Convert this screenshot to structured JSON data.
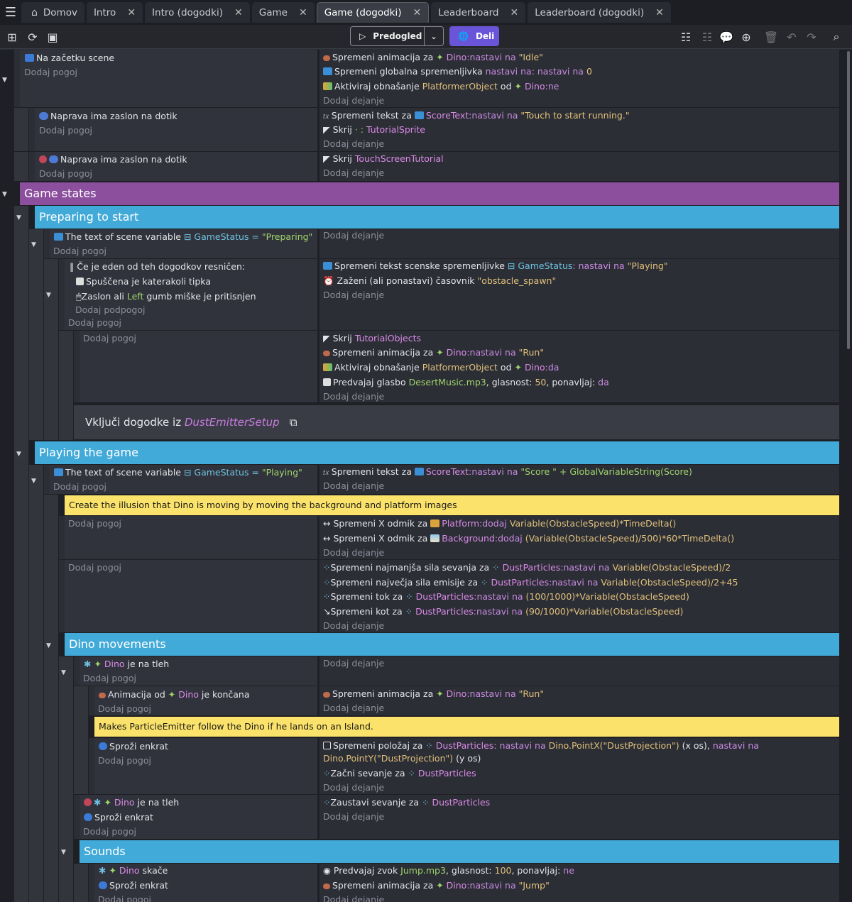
{
  "tabs": [
    {
      "label": "Domov",
      "closable": false
    },
    {
      "label": "Intro",
      "closable": true
    },
    {
      "label": "Intro (dogodki)",
      "closable": true
    },
    {
      "label": "Game",
      "closable": true
    },
    {
      "label": "Game (dogodki)",
      "closable": true,
      "active": true
    },
    {
      "label": "Leaderboard",
      "closable": true
    },
    {
      "label": "Leaderboard (dogodki)",
      "closable": true
    }
  ],
  "toolbar": {
    "preview_label": "Predogled",
    "share_label": "Deli"
  },
  "common": {
    "add_condition": "Dodaj pogoj",
    "add_action": "Dodaj dejanje",
    "add_subcondition": "Dodaj podpogoj"
  },
  "e1": {
    "cond": "Na začetku scene",
    "a1_pre": "Spremeni animacija za ",
    "a1_obj": "Dino",
    "a1_post": ":nastavi na ",
    "a1_val": "\"Idle\"",
    "a2_pre": "Spremeni globalna spremenljivka ",
    "a2_mid": "nastavi na: nastavi na ",
    "a2_val": "0",
    "a3_pre": "Aktiviraj obnašanje ",
    "a3_beh": "PlatformerObject",
    "a3_mid": " od ",
    "a3_obj": "Dino",
    "a3_post": ":ne"
  },
  "e2": {
    "cond": "Naprava ima zaslon na dotik",
    "a1_pre": "Spremeni tekst za ",
    "a1_obj": "ScoreText",
    "a1_post": ":nastavi na ",
    "a1_val": "\"Touch to start running.\"",
    "a2_pre": "Skrij ",
    "a2_obj": "TutorialSprite"
  },
  "e3": {
    "cond": "Naprava ima zaslon na dotik",
    "a1_pre": "Skrij ",
    "a1_obj": "TouchScreenTutorial"
  },
  "g_states": "Game states",
  "g_preparing": "Preparing to start",
  "e4": {
    "c_pre": "The text of scene variable ",
    "c_var": "GameStatus",
    "c_eq": " = ",
    "c_val": "\"Preparing\""
  },
  "e5": {
    "or": "Če je eden od teh dogodkov resničen:",
    "sub1": "Spuščena je katerakoli tipka",
    "sub2_pre": "Zaslon ali ",
    "sub2_kw": "Left",
    "sub2_post": " gumb miške je pritisnjen",
    "a1_pre": "Spremeni tekst scenske spremenljivke ",
    "a1_var": "GameStatus",
    "a1_mid": ": nastavi na ",
    "a1_val": "\"Playing\"",
    "a2_pre": "Zaženi (ali ponastavi) časovnik ",
    "a2_val": "\"obstacle_spawn\""
  },
  "e6": {
    "a1_pre": "Skrij ",
    "a1_obj": "TutorialObjects",
    "a2_pre": "Spremeni animacija za ",
    "a2_obj": "Dino",
    "a2_post": ":nastavi na ",
    "a2_val": "\"Run\"",
    "a3_pre": "Aktiviraj obnašanje ",
    "a3_beh": "PlatformerObject",
    "a3_mid": " od ",
    "a3_obj": "Dino",
    "a3_post": ":da",
    "a4_pre": "Predvajaj glasbo ",
    "a4_file": "DesertMusic.mp3",
    "a4_mid": ", glasnost: ",
    "a4_vol": "50",
    "a4_mid2": ", ponavljaj: ",
    "a4_loop": "da"
  },
  "link": {
    "pre": "Vključi dogodke iz ",
    "target": "DustEmitterSetup"
  },
  "g_playing": "Playing the game",
  "e7": {
    "c_pre": "The text of scene variable ",
    "c_var": "GameStatus",
    "c_eq": " = ",
    "c_val": "\"Playing\"",
    "a1_pre": "Spremeni tekst za ",
    "a1_obj": "ScoreText",
    "a1_post": ":nastavi na ",
    "a1_val": "\"Score \" + GlobalVariableString(Score)"
  },
  "comment1": "Create the illusion that Dino is moving by moving the background and platform images",
  "e8": {
    "a1_pre": "Spremeni X odmik za ",
    "a1_obj": "Platform",
    "a1_post": ":dodaj ",
    "a1_expr": "Variable(ObstacleSpeed)*TimeDelta()",
    "a2_pre": "Spremeni X odmik za ",
    "a2_obj": "Background",
    "a2_post": ":dodaj ",
    "a2_expr": "(Variable(ObstacleSpeed)/500)*60*TimeDelta()"
  },
  "e9": {
    "a1_pre": "Spremeni najmanjša sila sevanja za ",
    "a1_obj": "DustParticles",
    "a1_post": ":nastavi na ",
    "a1_expr": "Variable(ObstacleSpeed)/2",
    "a2_pre": "Spremeni največja sila emisije za ",
    "a2_obj": "DustParticles",
    "a2_post": ":nastavi na ",
    "a2_expr": "Variable(ObstacleSpeed)/2+45",
    "a3_pre": "Spremeni tok za ",
    "a3_obj": "DustParticles",
    "a3_post": ":nastavi na ",
    "a3_expr": "(100/1000)*Variable(ObstacleSpeed)",
    "a4_pre": "Spremeni kot za ",
    "a4_obj": "DustParticles",
    "a4_post": ":nastavi na ",
    "a4_expr": "(90/1000)*Variable(ObstacleSpeed)"
  },
  "g_dino": "Dino movements",
  "e10": {
    "c_obj": "Dino",
    "c_post": " je na tleh"
  },
  "e11": {
    "c_pre": "Animacija od ",
    "c_obj": "Dino",
    "c_post": " je končana",
    "a1_pre": "Spremeni animacija za ",
    "a1_obj": "Dino",
    "a1_post": ":nastavi na ",
    "a1_val": "\"Run\""
  },
  "comment2": "Makes ParticleEmitter follow the Dino if he lands on an Island.",
  "e12": {
    "cond": "Sproži enkrat",
    "a1_pre": "Spremeni položaj za ",
    "a1_obj": "DustParticles",
    "a1_mid": ": nastavi na ",
    "a1_x": "Dino.PointX(\"DustProjection\")",
    "a1_xl": " (x os), ",
    "a1_mid2": "nastavi na",
    "a1_y": "Dino.PointY(\"DustProjection\")",
    "a1_yl": " (y os)",
    "a2_pre": "Začni sevanje za ",
    "a2_obj": "DustParticles"
  },
  "e13": {
    "c_obj": "Dino",
    "c_post": " je na tleh",
    "c2": "Sproži enkrat",
    "a1_pre": "Zaustavi sevanje za ",
    "a1_obj": "DustParticles"
  },
  "g_sounds": "Sounds",
  "e14": {
    "c_obj": "Dino",
    "c_post": " skače",
    "c2": "Sproži enkrat",
    "a1_pre": "Predvajaj zvok ",
    "a1_file": "Jump.mp3",
    "a1_mid": ", glasnost: ",
    "a1_vol": "100",
    "a1_mid2": ", ponavljaj: ",
    "a1_loop": "ne",
    "a2_pre": "Spremeni animacija za ",
    "a2_obj": "Dino",
    "a2_post": ":nastavi na ",
    "a2_val": "\"Jump\""
  }
}
